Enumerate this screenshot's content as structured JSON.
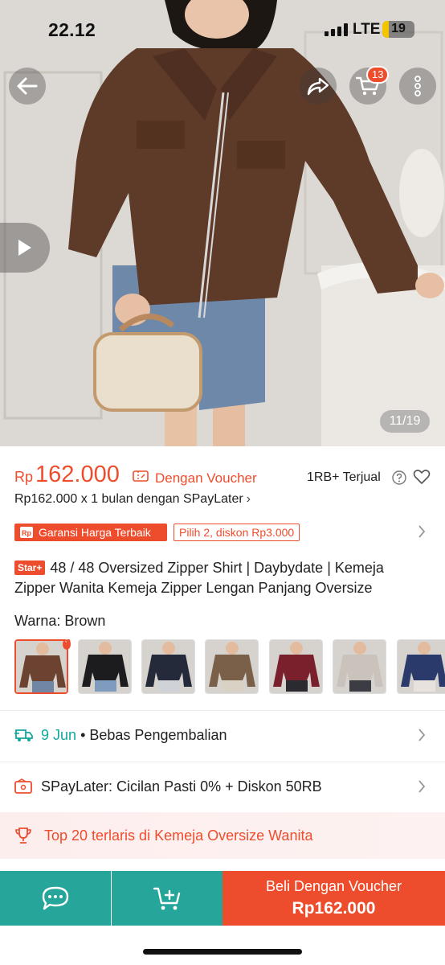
{
  "status_bar": {
    "time": "22.12",
    "network": "LTE",
    "battery": "19"
  },
  "header": {
    "cart_count": "13",
    "image_counter": "11/19"
  },
  "product": {
    "currency": "Rp",
    "price": "162.000",
    "voucher_label": "Dengan Voucher",
    "sold": "1RB+ Terjual",
    "paylater": "Rp162.000 x 1 bulan dengan SPayLater",
    "badge_best_price": "Garansi Harga Terbaik",
    "badge_discount": "Pilih 2, diskon Rp3.000",
    "star_tag": "Star+",
    "title": "48 / 48 Oversized Zipper Shirt | Daybydate | Kemeja Zipper Wanita Kemeja Zipper Lengan Panjang Oversize",
    "variant_label": "Warna:",
    "variant_value": "Brown"
  },
  "swatches": [
    {
      "color": "#6b4330",
      "bottom": "#6f87a5"
    },
    {
      "color": "#1c1c1e",
      "bottom": "#7f9bbd"
    },
    {
      "color": "#242a3a",
      "bottom": "#cfd3d8"
    },
    {
      "color": "#7a6048",
      "bottom": "#d9d1c4"
    },
    {
      "color": "#7a1f2c",
      "bottom": "#2a2a30"
    },
    {
      "color": "#c9c3bc",
      "bottom": "#3c3c44"
    },
    {
      "color": "#2a3a6a",
      "bottom": "#e7e3dc"
    }
  ],
  "shipping": {
    "date": "9 Jun",
    "separator": "•",
    "returns": "Bebas Pengembalian"
  },
  "paylater_row": {
    "text": "SPayLater: Cicilan Pasti 0% + Diskon 50RB"
  },
  "top_seller": {
    "text": "Top 20 terlaris di Kemeja Oversize Wanita"
  },
  "bottom_bar": {
    "buy_label": "Beli Dengan Voucher",
    "buy_price": "Rp162.000"
  },
  "colors": {
    "accent": "#ee4d2d",
    "teal": "#26a69a",
    "shipping": "#13a89e"
  }
}
